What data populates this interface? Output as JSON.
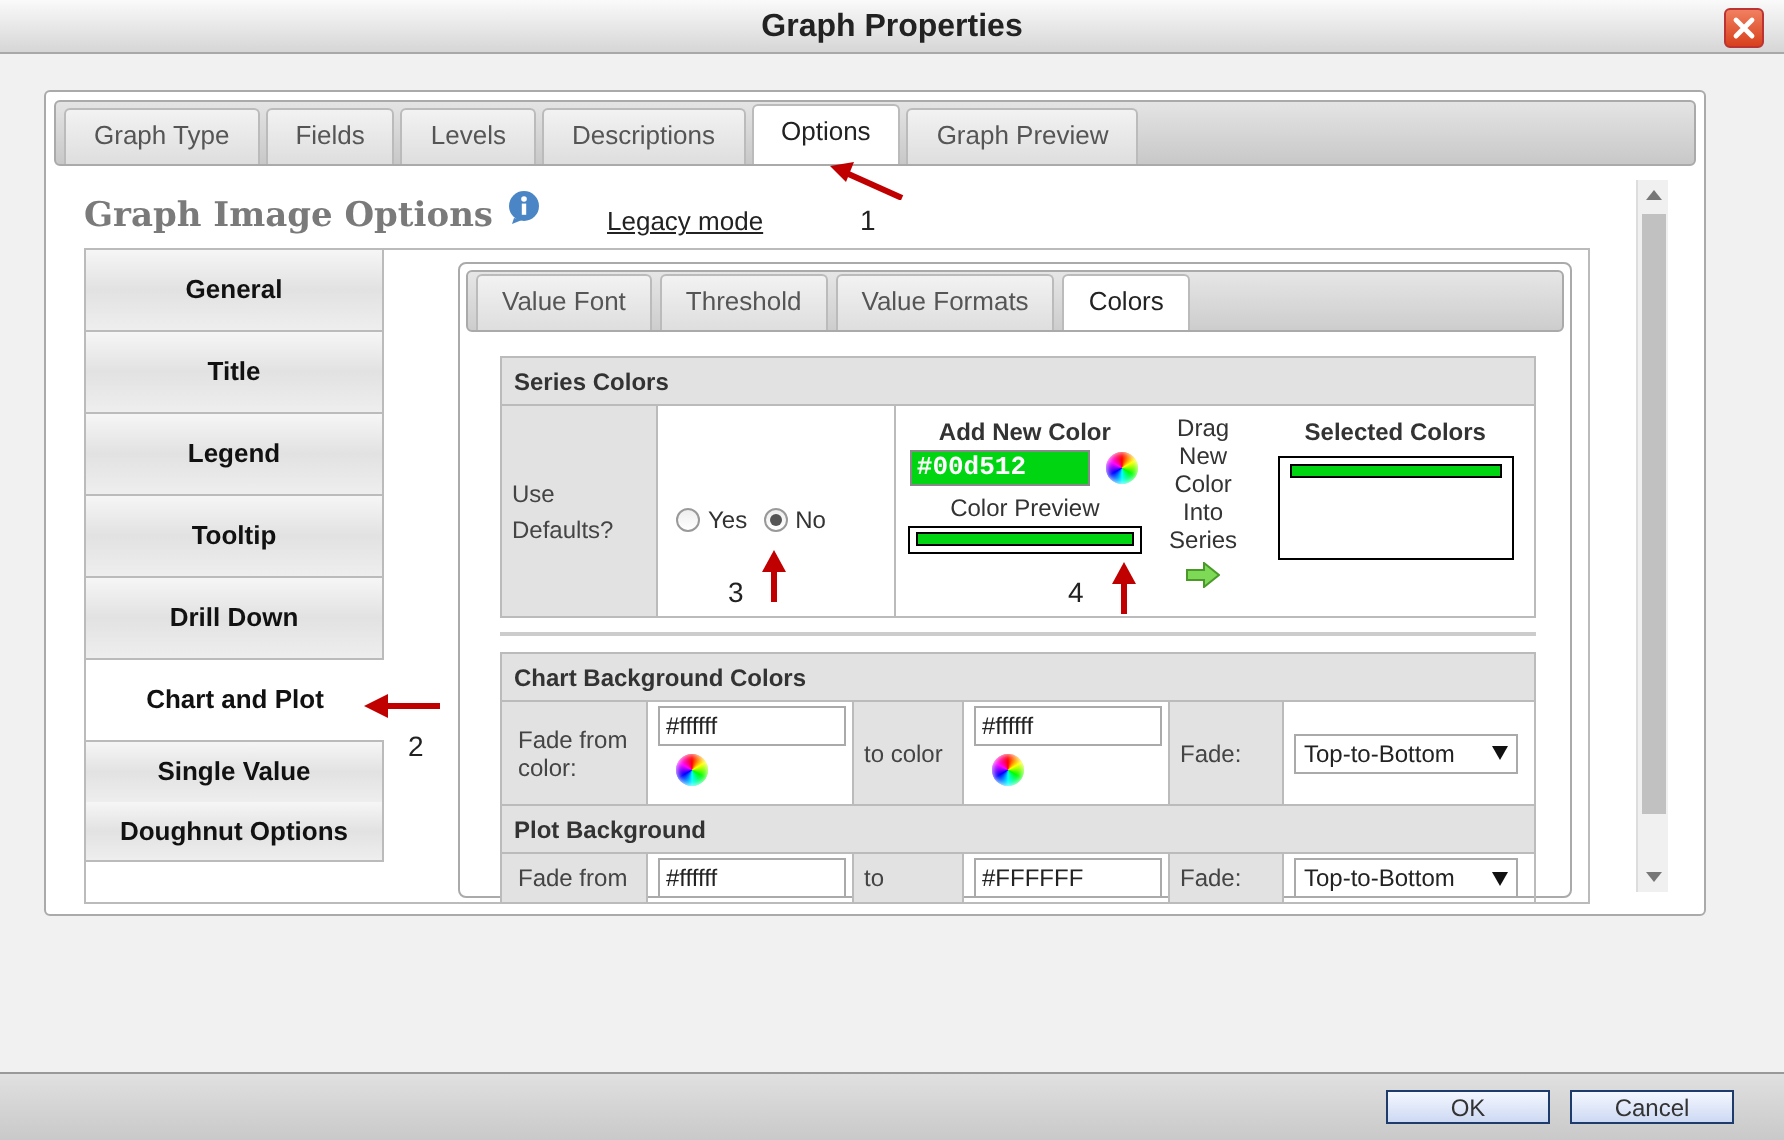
{
  "window": {
    "title": "Graph Properties"
  },
  "tabs": [
    {
      "label": "Graph Type",
      "selected": false
    },
    {
      "label": "Fields",
      "selected": false
    },
    {
      "label": "Levels",
      "selected": false
    },
    {
      "label": "Descriptions",
      "selected": false
    },
    {
      "label": "Options",
      "selected": true
    },
    {
      "label": "Graph Preview",
      "selected": false
    }
  ],
  "heading": "Graph Image Options",
  "legacy_link": "Legacy mode",
  "sidebar": {
    "items": [
      {
        "label": "General",
        "selected": false
      },
      {
        "label": "Title",
        "selected": false
      },
      {
        "label": "Legend",
        "selected": false
      },
      {
        "label": "Tooltip",
        "selected": false
      },
      {
        "label": "Drill Down",
        "selected": false
      },
      {
        "label": "Chart and Plot",
        "selected": true
      },
      {
        "label": "Single Value",
        "selected": false
      },
      {
        "label": "Doughnut Options",
        "selected": false
      }
    ]
  },
  "subtabs": [
    {
      "label": "Value Font",
      "selected": false
    },
    {
      "label": "Threshold",
      "selected": false
    },
    {
      "label": "Value Formats",
      "selected": false
    },
    {
      "label": "Colors",
      "selected": true
    }
  ],
  "series_colors": {
    "title": "Series Colors",
    "use_defaults_label": "Use Defaults?",
    "options": [
      {
        "label": "Yes",
        "selected": false
      },
      {
        "label": "No",
        "selected": true
      }
    ],
    "add_new_color": {
      "title": "Add New Color",
      "value": "#00d512",
      "color": "#00d512",
      "preview_label": "Color Preview"
    },
    "drag_hint": "Drag New Color Into Series",
    "selected_colors": {
      "title": "Selected Colors",
      "items": [
        {
          "color": "#00d512"
        }
      ]
    }
  },
  "chart_background": {
    "title": "Chart Background Colors",
    "from_label": "Fade from color:",
    "from_value": "#ffffff",
    "to_label": "to color",
    "to_value": "#ffffff",
    "fade_label": "Fade:",
    "fade_value": "Top-to-Bottom"
  },
  "plot_background": {
    "title": "Plot Background",
    "from_label": "Fade from",
    "from_value": "#ffffff",
    "to_label": "to",
    "to_value": "#FFFFFF",
    "fade_label": "Fade:",
    "fade_value": "Top-to-Bottom"
  },
  "annotations": [
    {
      "label": "1"
    },
    {
      "label": "2"
    },
    {
      "label": "3"
    },
    {
      "label": "4"
    }
  ],
  "buttons": [
    "OK",
    "Cancel"
  ]
}
